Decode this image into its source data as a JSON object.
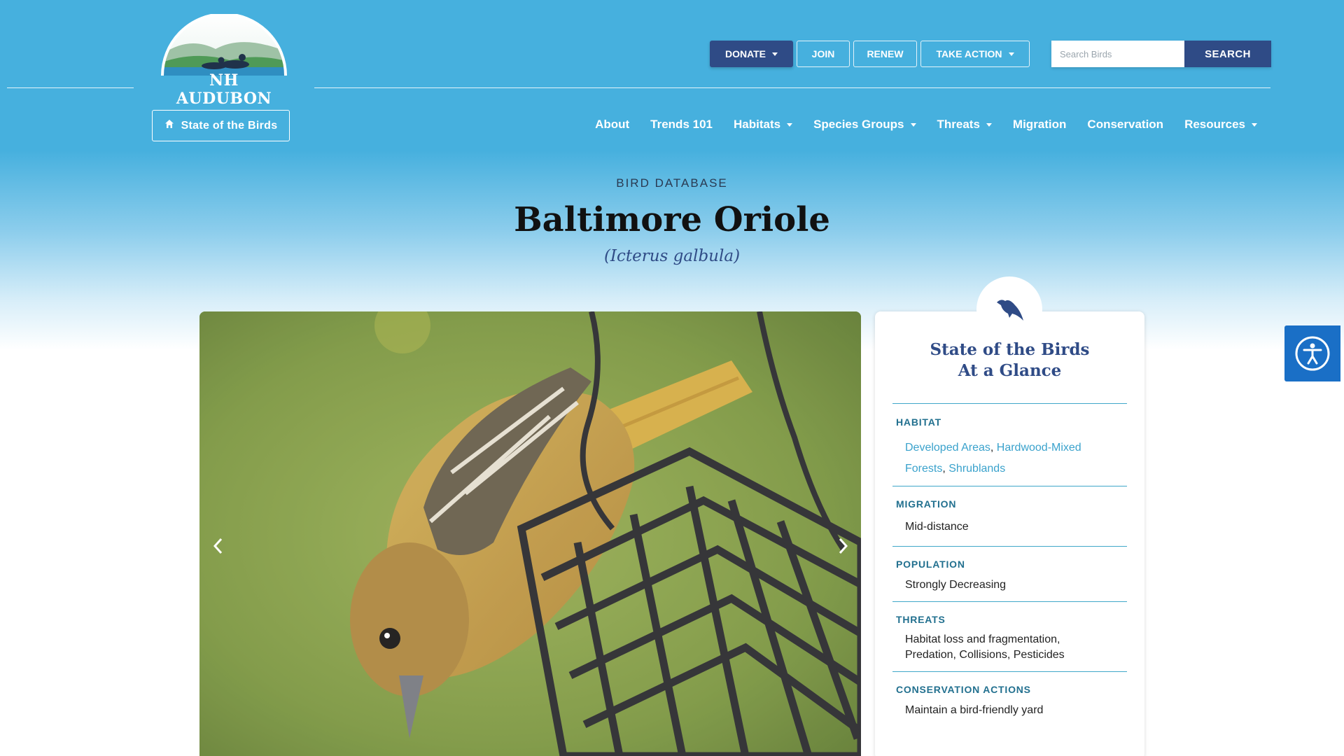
{
  "brand": {
    "name": "NH AUDUBON"
  },
  "colors": {
    "accent": "#2f4b86",
    "header_blue": "#46b0de",
    "link": "#3aa2cc"
  },
  "header": {
    "sotb_label": "State of the Birds",
    "actions": {
      "donate": "DONATE",
      "join": "JOIN",
      "renew": "RENEW",
      "take_action": "TAKE ACTION"
    },
    "search": {
      "placeholder": "Search Birds",
      "button": "SEARCH"
    },
    "nav": {
      "about": "About",
      "trends": "Trends 101",
      "habitats": "Habitats",
      "species_groups": "Species Groups",
      "threats": "Threats",
      "migration": "Migration",
      "conservation": "Conservation",
      "resources": "Resources"
    }
  },
  "page": {
    "eyebrow": "BIRD DATABASE",
    "title": "Baltimore Oriole",
    "scientific_name": "(Icterus galbula)"
  },
  "glance": {
    "title_line1": "State of the Birds",
    "title_line2": "At a Glance",
    "habitat": {
      "heading": "HABITAT",
      "links": [
        "Developed Areas",
        "Hardwood-Mixed",
        "Forests",
        "Shrublands"
      ],
      "separator": ","
    },
    "migration": {
      "heading": "MIGRATION",
      "value": "Mid-distance"
    },
    "population": {
      "heading": "POPULATION",
      "value": "Strongly Decreasing"
    },
    "threats": {
      "heading": "THREATS",
      "line1": "Habitat loss and fragmentation,",
      "line2": "Predation, Collisions, Pesticides"
    },
    "conservation": {
      "heading": "CONSERVATION ACTIONS",
      "value": "Maintain a bird-friendly yard"
    }
  },
  "icons": [
    "home-icon",
    "caret-down-icon",
    "bird-icon",
    "chevron-left-icon",
    "chevron-right-icon",
    "accessibility-icon"
  ]
}
